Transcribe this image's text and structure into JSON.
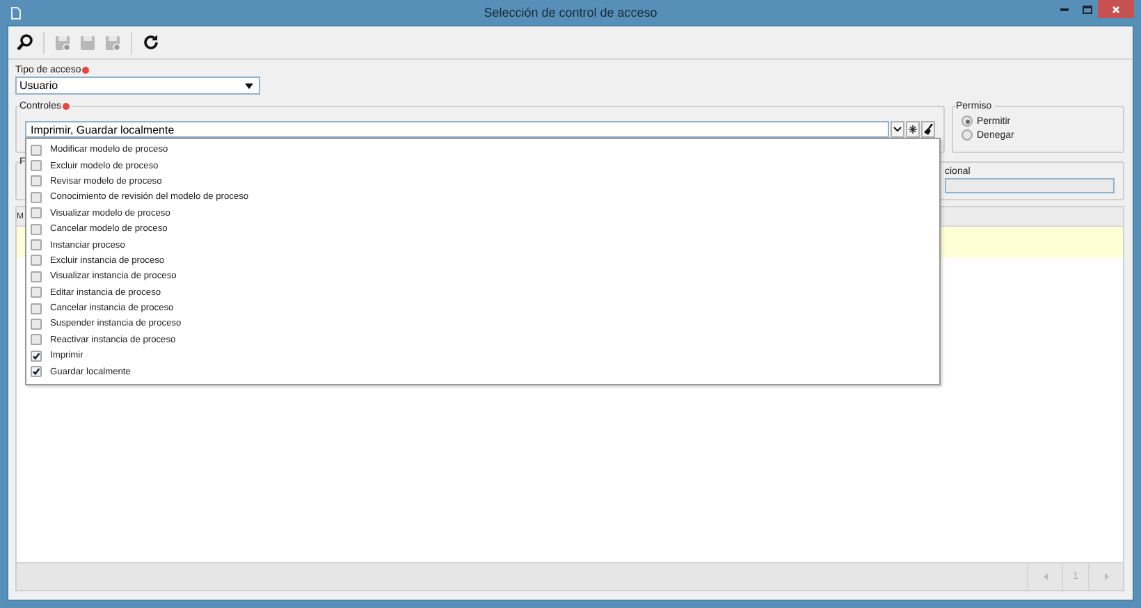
{
  "window": {
    "title": "Selección de control de acceso"
  },
  "access_type": {
    "label": "Tipo de acceso",
    "required": true,
    "value": "Usuario"
  },
  "controls": {
    "label": "Controles",
    "required": true,
    "value": "Imprimir, Guardar localmente",
    "expanded": true,
    "options": [
      {
        "label": "Modificar modelo de proceso",
        "checked": false
      },
      {
        "label": "Excluir modelo de proceso",
        "checked": false
      },
      {
        "label": "Revisar modelo de proceso",
        "checked": false
      },
      {
        "label": "Conocimiento de revisión del modelo de proceso",
        "checked": false
      },
      {
        "label": "Visualizar modelo de proceso",
        "checked": false
      },
      {
        "label": "Cancelar modelo de proceso",
        "checked": false
      },
      {
        "label": "Instanciar proceso",
        "checked": false
      },
      {
        "label": "Excluir instancia de proceso",
        "checked": false
      },
      {
        "label": "Visualizar instancia de proceso",
        "checked": false
      },
      {
        "label": "Editar instancia de proceso",
        "checked": false
      },
      {
        "label": "Cancelar instancia de proceso",
        "checked": false
      },
      {
        "label": "Suspender instancia de proceso",
        "checked": false
      },
      {
        "label": "Reactivar instancia de proceso",
        "checked": false
      },
      {
        "label": "Imprimir",
        "checked": true
      },
      {
        "label": "Guardar localmente",
        "checked": true
      }
    ]
  },
  "permission": {
    "label": "Permiso",
    "options": [
      {
        "label": "Permitir",
        "selected": true
      },
      {
        "label": "Denegar",
        "selected": false
      }
    ]
  },
  "group": {
    "label": "F",
    "field_label": "cional"
  },
  "grid": {
    "column_1": "M",
    "pager": {
      "page": "1"
    }
  }
}
